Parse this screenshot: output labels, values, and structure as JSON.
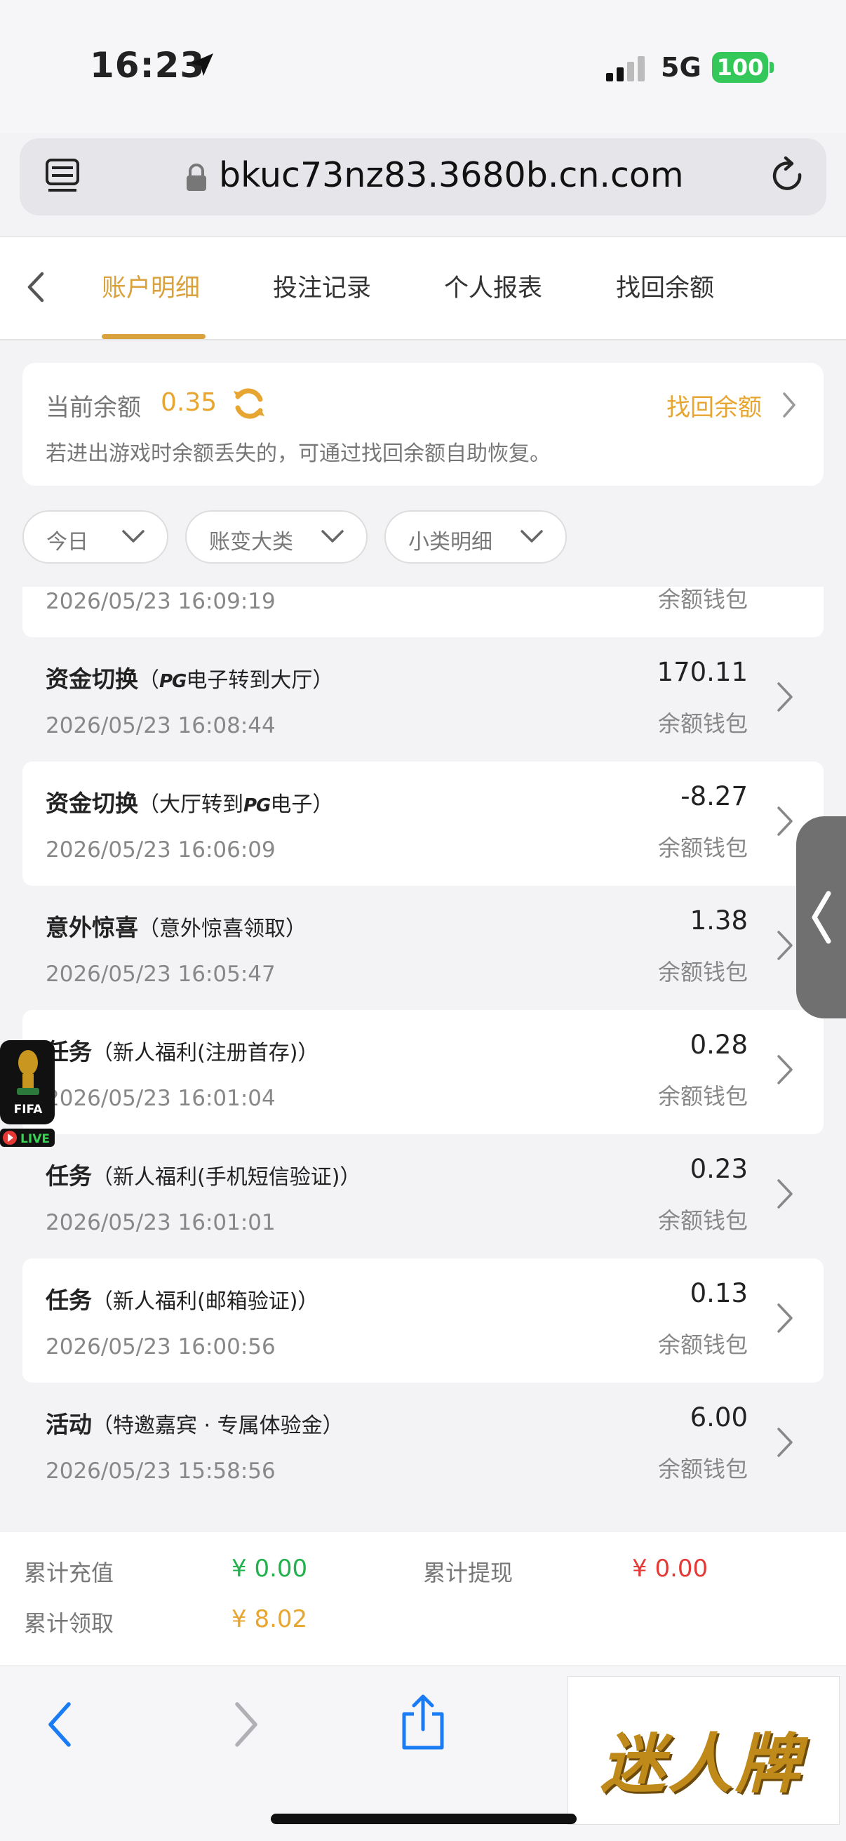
{
  "status": {
    "time": "16:23",
    "network": "5G",
    "battery": "100"
  },
  "browser": {
    "url": "bkuc73nz83.3680b.cn.com"
  },
  "tabs": [
    {
      "label": "账户明细",
      "active": true
    },
    {
      "label": "投注记录",
      "active": false
    },
    {
      "label": "个人报表",
      "active": false
    },
    {
      "label": "找回余额",
      "active": false
    }
  ],
  "balance": {
    "label": "当前余额",
    "value": "0.35",
    "recover_label": "找回余额",
    "note": "若进出游戏时余额丢失的，可通过找回余额自助恢复。"
  },
  "filters": {
    "date": "今日",
    "category": "账变大类",
    "subcategory": "小类明细"
  },
  "records": [
    {
      "type": "",
      "detail": "",
      "date": "2026/05/23 16:09:19",
      "amount": "",
      "wallet": "余额钱包"
    },
    {
      "type": "资金切换",
      "detail_pre": "（",
      "pg": "PG",
      "detail": "电子转到大厅）",
      "date": "2026/05/23 16:08:44",
      "amount": "170.11",
      "wallet": "余额钱包"
    },
    {
      "type": "资金切换",
      "detail_pre": "（大厅转到",
      "pg": "PG",
      "detail": "电子）",
      "date": "2026/05/23 16:06:09",
      "amount": "-8.27",
      "wallet": "余额钱包"
    },
    {
      "type": "意外惊喜",
      "detail": "（意外惊喜领取）",
      "date": "2026/05/23 16:05:47",
      "amount": "1.38",
      "wallet": "余额钱包"
    },
    {
      "type": "任务",
      "detail": "（新人福利(注册首存)）",
      "date": "2026/05/23 16:01:04",
      "amount": "0.28",
      "wallet": "余额钱包"
    },
    {
      "type": "任务",
      "detail": "（新人福利(手机短信验证)）",
      "date": "2026/05/23 16:01:01",
      "amount": "0.23",
      "wallet": "余额钱包"
    },
    {
      "type": "任务",
      "detail": "（新人福利(邮箱验证)）",
      "date": "2026/05/23 16:00:56",
      "amount": "0.13",
      "wallet": "余额钱包"
    },
    {
      "type": "活动",
      "detail": "（特邀嘉宾 · 专属体验金）",
      "date": "2026/05/23 15:58:56",
      "amount": "6.00",
      "wallet": "余额钱包"
    }
  ],
  "fifa": {
    "label": "FIFA",
    "live": "LIVE"
  },
  "totals": {
    "deposit_label": "累计充值",
    "deposit_value": "¥ 0.00",
    "withdraw_label": "累计提现",
    "withdraw_value": "¥ 0.00",
    "claimed_label": "累计领取",
    "claimed_value": "¥ 8.02"
  },
  "brand": {
    "text": "迷人牌"
  },
  "colors": {
    "accent": "#d9a23c",
    "gold": "#e7a531",
    "green": "#22b14c",
    "red": "#e53935",
    "ios_blue": "#1a7cf5"
  }
}
